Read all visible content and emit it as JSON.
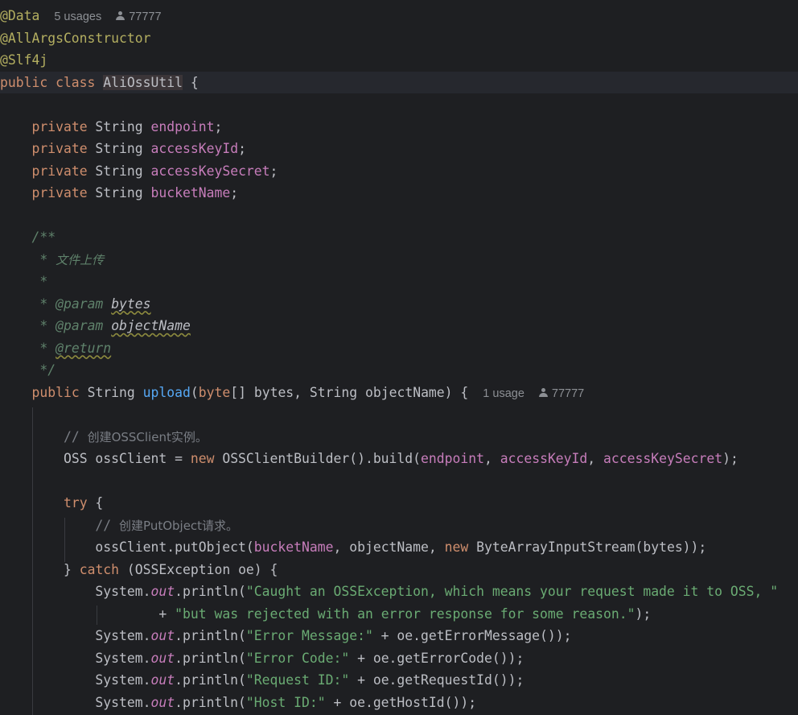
{
  "annotations": {
    "data": "@Data",
    "all_args": "@AllArgsConstructor",
    "slf4j": "@Slf4j"
  },
  "class_hints": {
    "usages": "5 usages",
    "author": "77777"
  },
  "class_decl": {
    "modifiers": "public class ",
    "name": "AliOssUtil",
    "brace": " {"
  },
  "fields": [
    {
      "modifier": "private",
      "type": " String ",
      "name": "endpoint",
      "end": ";"
    },
    {
      "modifier": "private",
      "type": " String ",
      "name": "accessKeyId",
      "end": ";"
    },
    {
      "modifier": "private",
      "type": " String ",
      "name": "accessKeySecret",
      "end": ";"
    },
    {
      "modifier": "private",
      "type": " String ",
      "name": "bucketName",
      "end": ";"
    }
  ],
  "javadoc": {
    "open": "/**",
    "summary_star": " * ",
    "summary": "文件上传",
    "blank": " *",
    "param_star": " * ",
    "param_tag": "@param",
    "param1": "bytes",
    "param2": "objectName",
    "return_tag": "@return",
    "close": " */"
  },
  "method_decl": {
    "public": "public",
    "ret_type": " String ",
    "name": "upload",
    "params_a": "(",
    "byte_kw": "byte",
    "params_b": "[] bytes, String objectName) {"
  },
  "method_hints": {
    "usages": "1 usage",
    "author": "77777"
  },
  "body": {
    "comment1_prefix": "// ",
    "comment1": "创建OSSClient实例。",
    "oss_a": "OSS ossClient = ",
    "new_kw": "new",
    "oss_b": " OSSClientBuilder().build(",
    "endpoint": "endpoint",
    "comma": ", ",
    "access_key_id": "accessKeyId",
    "access_key_secret": "accessKeySecret",
    "oss_end": ");",
    "try_kw": "try",
    "try_brace": " {",
    "comment2_prefix": "// ",
    "comment2": "创建PutObject请求。",
    "put_a": "ossClient.putObject(",
    "bucket_name": "bucketName",
    "put_b": ", objectName, ",
    "put_c": " ByteArrayInputStream(bytes));",
    "catch_brace": "} ",
    "catch_kw": "catch",
    "catch_b": " (OSSException oe) {",
    "system": "System.",
    "out": "out",
    "println_open": ".println(",
    "msg1": "\"Caught an OSSException, which means your request made it to OSS, \"",
    "concat_plus": "+ ",
    "msg2": "\"but was rejected with an error response for some reason.\"",
    "msg2_end": ");",
    "err_msg_str": "\"Error Message:\"",
    "err_msg_rest": " + oe.getErrorMessage());",
    "err_code_str": "\"Error Code:\"",
    "err_code_rest": " + oe.getErrorCode());",
    "req_id_str": "\"Request ID:\"",
    "req_id_rest": " + oe.getRequestId());",
    "host_id_str": "\"Host ID:\"",
    "host_id_rest": " + oe.getHostId());"
  }
}
